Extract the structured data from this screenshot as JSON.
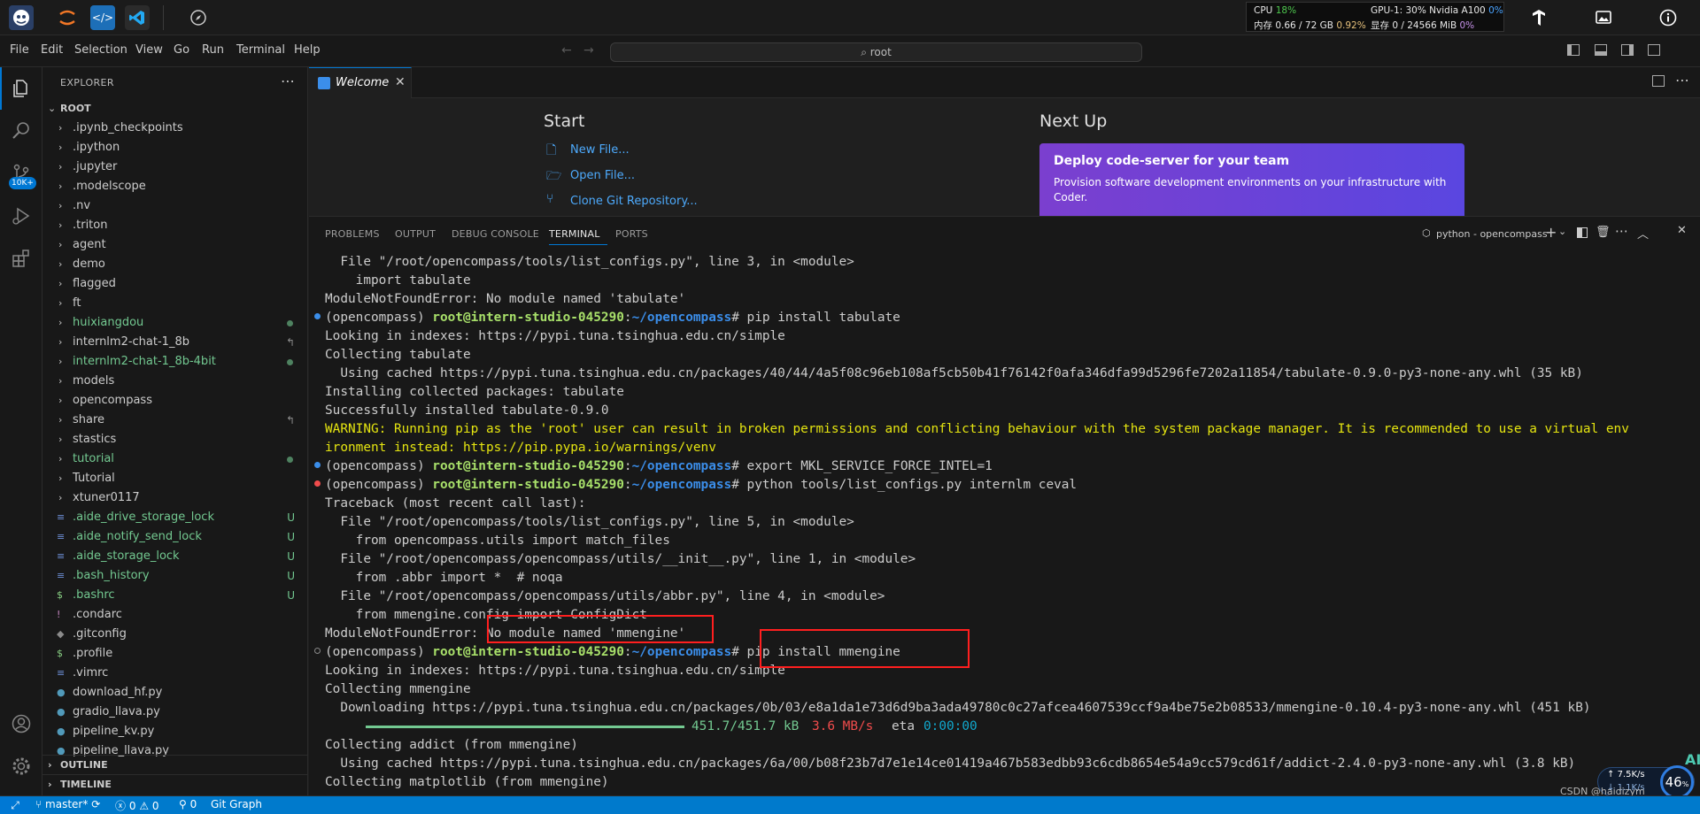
{
  "sysbar": {
    "cpu_label": "CPU",
    "cpu_pct": "18%",
    "mem_label": "内存 0.66 / 72 GB",
    "mem_pct": "0.92%",
    "gpu_label": "GPU-1: 30% Nvidia A100",
    "gpu_pct": "0%",
    "vram_label": "显存 0 / 24566 MiB",
    "vram_pct": "0%"
  },
  "menu": [
    "File",
    "Edit",
    "Selection",
    "View",
    "Go",
    "Run",
    "Terminal",
    "Help"
  ],
  "command_center": "root",
  "explorer": {
    "title": "EXPLORER",
    "root": "ROOT",
    "items": [
      {
        "label": ".ipynb_checkpoints",
        "type": "folder",
        "color": "#cccccc",
        "badge": ""
      },
      {
        "label": ".ipython",
        "type": "folder",
        "color": "#cccccc",
        "badge": ""
      },
      {
        "label": ".jupyter",
        "type": "folder",
        "color": "#cccccc",
        "badge": ""
      },
      {
        "label": ".modelscope",
        "type": "folder",
        "color": "#cccccc",
        "badge": ""
      },
      {
        "label": ".nv",
        "type": "folder",
        "color": "#cccccc",
        "badge": ""
      },
      {
        "label": ".triton",
        "type": "folder",
        "color": "#cccccc",
        "badge": ""
      },
      {
        "label": "agent",
        "type": "folder",
        "color": "#cccccc",
        "badge": ""
      },
      {
        "label": "demo",
        "type": "folder",
        "color": "#cccccc",
        "badge": ""
      },
      {
        "label": "flagged",
        "type": "folder",
        "color": "#cccccc",
        "badge": ""
      },
      {
        "label": "ft",
        "type": "folder",
        "color": "#cccccc",
        "badge": ""
      },
      {
        "label": "huixiangdou",
        "type": "folder",
        "color": "#73c991",
        "badge": "dot"
      },
      {
        "label": "internlm2-chat-1_8b",
        "type": "folder",
        "color": "#cccccc",
        "badge": "link"
      },
      {
        "label": "internlm2-chat-1_8b-4bit",
        "type": "folder",
        "color": "#73c991",
        "badge": "dot"
      },
      {
        "label": "models",
        "type": "folder",
        "color": "#cccccc",
        "badge": ""
      },
      {
        "label": "opencompass",
        "type": "folder",
        "color": "#cccccc",
        "badge": ""
      },
      {
        "label": "share",
        "type": "folder",
        "color": "#cccccc",
        "badge": "link"
      },
      {
        "label": "stastics",
        "type": "folder",
        "color": "#cccccc",
        "badge": ""
      },
      {
        "label": "tutorial",
        "type": "folder",
        "color": "#73c991",
        "badge": "dot"
      },
      {
        "label": "Tutorial",
        "type": "folder",
        "color": "#cccccc",
        "badge": ""
      },
      {
        "label": "xtuner0117",
        "type": "folder",
        "color": "#cccccc",
        "badge": ""
      },
      {
        "label": ".aide_drive_storage_lock",
        "type": "file",
        "icon": "≡",
        "icon_color": "#6d8fd6",
        "color": "#73c991",
        "badge": "U"
      },
      {
        "label": ".aide_notify_send_lock",
        "type": "file",
        "icon": "≡",
        "icon_color": "#6d8fd6",
        "color": "#73c991",
        "badge": "U"
      },
      {
        "label": ".aide_storage_lock",
        "type": "file",
        "icon": "≡",
        "icon_color": "#6d8fd6",
        "color": "#73c991",
        "badge": "U"
      },
      {
        "label": ".bash_history",
        "type": "file",
        "icon": "≡",
        "icon_color": "#6d8fd6",
        "color": "#73c991",
        "badge": "U"
      },
      {
        "label": ".bashrc",
        "type": "file",
        "icon": "$",
        "icon_color": "#89d185",
        "color": "#73c991",
        "badge": "U"
      },
      {
        "label": ".condarc",
        "type": "file",
        "icon": "!",
        "icon_color": "#c586c0",
        "color": "#cccccc",
        "badge": ""
      },
      {
        "label": ".gitconfig",
        "type": "file",
        "icon": "◆",
        "icon_color": "#8b8b8b",
        "color": "#cccccc",
        "badge": ""
      },
      {
        "label": ".profile",
        "type": "file",
        "icon": "$",
        "icon_color": "#89d185",
        "color": "#cccccc",
        "badge": ""
      },
      {
        "label": ".vimrc",
        "type": "file",
        "icon": "≡",
        "icon_color": "#6d8fd6",
        "color": "#cccccc",
        "badge": ""
      },
      {
        "label": "download_hf.py",
        "type": "file",
        "icon": "●",
        "icon_color": "#519aba",
        "color": "#cccccc",
        "badge": ""
      },
      {
        "label": "gradio_llava.py",
        "type": "file",
        "icon": "●",
        "icon_color": "#519aba",
        "color": "#cccccc",
        "badge": ""
      },
      {
        "label": "pipeline_kv.py",
        "type": "file",
        "icon": "●",
        "icon_color": "#519aba",
        "color": "#cccccc",
        "badge": ""
      },
      {
        "label": "pipeline_llava.py",
        "type": "file",
        "icon": "●",
        "icon_color": "#519aba",
        "color": "#cccccc",
        "badge": ""
      }
    ],
    "outline": "OUTLINE",
    "timeline": "TIMELINE"
  },
  "tab": {
    "label": "Welcome"
  },
  "welcome": {
    "start_title": "Start",
    "links": [
      "New File...",
      "Open File...",
      "Clone Git Repository..."
    ],
    "next_title": "Next Up",
    "deploy_title": "Deploy code-server for your team",
    "deploy_text": "Provision software development environments on your infrastructure with Coder."
  },
  "panel": {
    "tabs": [
      "PROBLEMS",
      "OUTPUT",
      "DEBUG CONSOLE",
      "TERMINAL",
      "PORTS"
    ],
    "active_tab": "TERMINAL",
    "terminal_name": "python - opencompass"
  },
  "terminal": {
    "prompt_env": "(opencompass) ",
    "prompt_user": "root@intern-studio-045290",
    "prompt_path": "~/opencompass",
    "lines": [
      "  File \"/root/opencompass/tools/list_configs.py\", line 3, in <module>",
      "    import tabulate",
      "ModuleNotFoundError: No module named 'tabulate'",
      "pip install tabulate",
      "Looking in indexes: https://pypi.tuna.tsinghua.edu.cn/simple",
      "Collecting tabulate",
      "  Using cached https://pypi.tuna.tsinghua.edu.cn/packages/40/44/4a5f08c96eb108af5cb50b41f76142f0afa346dfa99d5296fe7202a11854/tabulate-0.9.0-py3-none-any.whl (35 kB)",
      "Installing collected packages: tabulate",
      "Successfully installed tabulate-0.9.0",
      "WARNING: Running pip as the 'root' user can result in broken permissions and conflicting behaviour with the system package manager. It is recommended to use a virtual env",
      "ironment instead: https://pip.pypa.io/warnings/venv",
      "export MKL_SERVICE_FORCE_INTEL=1",
      "python tools/list_configs.py internlm ceval",
      "Traceback (most recent call last):",
      "  File \"/root/opencompass/tools/list_configs.py\", line 5, in <module>",
      "    from opencompass.utils import match_files",
      "  File \"/root/opencompass/opencompass/utils/__init__.py\", line 1, in <module>",
      "    from .abbr import *  # noqa",
      "  File \"/root/opencompass/opencompass/utils/abbr.py\", line 4, in <module>",
      "    from mmengine.config import ConfigDict",
      "ModuleNotFoundError: No module named 'mmengine'",
      "pip install mmengine",
      "Looking in indexes: https://pypi.tuna.tsinghua.edu.cn/simple",
      "Collecting mmengine",
      "  Downloading https://pypi.tuna.tsinghua.edu.cn/packages/0b/03/e8a1da1e73d6d9ba3ada49780c0c27afcea4607539ccf9a4be75e2b08533/mmengine-0.10.4-py3-none-any.whl (451 kB)",
      "451.7/451.7 kB",
      "3.6 MB/s",
      "eta",
      "0:00:00",
      "Collecting addict (from mmengine)",
      "  Using cached https://pypi.tuna.tsinghua.edu.cn/packages/6a/00/b08f23b7d7e1e14ce01419a467b583edbb93c6cdb8654e54a9cc579cd61f/addict-2.4.0-py3-none-any.whl (3.8 kB)",
      "Collecting matplotlib (from mmengine)"
    ]
  },
  "statusbar": {
    "branch": "master*",
    "errors": "0",
    "warnings": "0",
    "ports": "0",
    "git_graph": "Git Graph",
    "net_speed": "7.5K/s",
    "net_down": "1.1K/s",
    "gauge": "46",
    "gauge_unit": "%",
    "watermark": "CSDN @haidizym",
    "ai_label": "AI"
  }
}
